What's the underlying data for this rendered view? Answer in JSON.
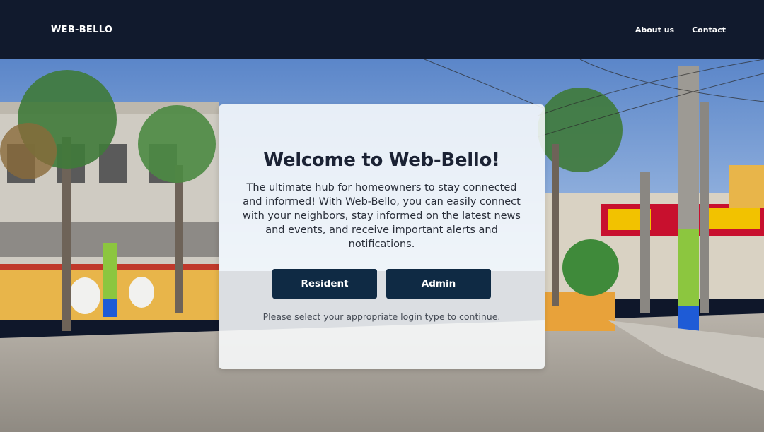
{
  "nav": {
    "brand": "WEB-BELLO",
    "links": [
      {
        "label": "About us"
      },
      {
        "label": "Contact"
      }
    ]
  },
  "hero": {
    "title": "Welcome to Web-Bello!",
    "description": "The ultimate hub for homeowners to stay connected and informed! With Web-Bello, you can easily connect with your neighbors, stay informed on the latest news and events, and receive important alerts and notifications.",
    "buttons": {
      "resident": "Resident",
      "admin": "Admin"
    },
    "note": "Please select your appropriate login type to continue."
  },
  "colors": {
    "navbar": "#111a2d",
    "button": "#0f2a44",
    "title": "#1b2234"
  }
}
